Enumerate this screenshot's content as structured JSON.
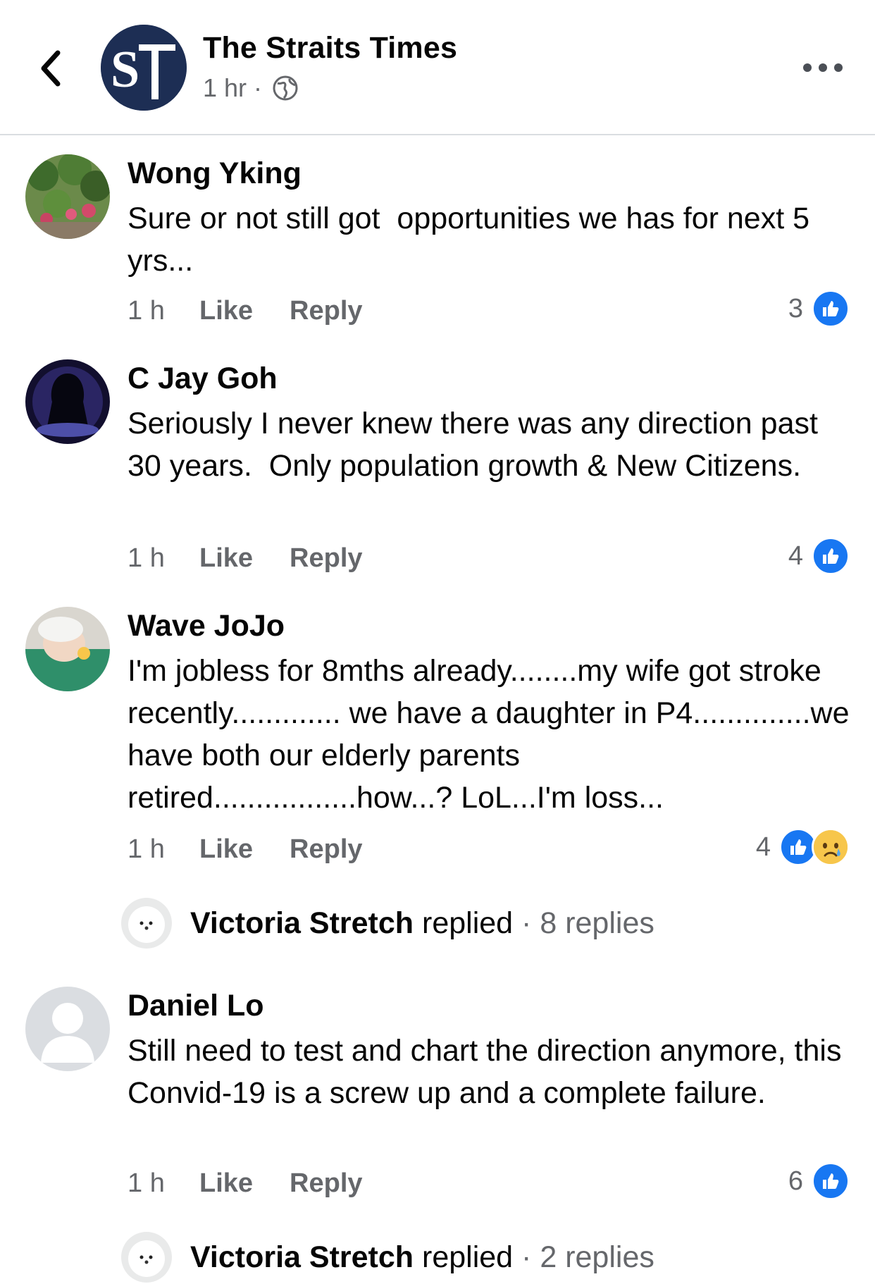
{
  "header": {
    "page_name": "The Straits Times",
    "time": "1 hr",
    "separator": "·",
    "privacy_icon": "globe-icon",
    "back_icon": "chevron-left-icon",
    "more_icon": "more-horizontal-icon",
    "logo_text": "ST",
    "brand_color": "#1d2e54"
  },
  "actions": {
    "like_label": "Like",
    "reply_label": "Reply"
  },
  "comments": [
    {
      "name": "Wong Yking",
      "text": "Sure or not still got  opportunities we has for next 5 yrs...",
      "time": "1 h",
      "reaction_count": "3",
      "reactions": [
        "like-icon"
      ]
    },
    {
      "name": "C Jay Goh",
      "text": "Seriously I never knew there was any direction past 30 years.  Only population growth & New Citizens.",
      "time": "1 h",
      "reaction_count": "4",
      "reactions": [
        "like-icon"
      ]
    },
    {
      "name": "Wave JoJo",
      "text": "I'm jobless for 8mths already........my wife got stroke recently............. we have a daughter in P4..............we have both our elderly parents retired.................how...? LoL...I'm loss...",
      "time": "1 h",
      "reaction_count": "4",
      "reactions": [
        "like-icon",
        "sad-icon"
      ],
      "reply_summary": {
        "name": "Victoria Stretch",
        "verb": "replied",
        "separator": "·",
        "count": "8 replies"
      }
    },
    {
      "name": "Daniel Lo",
      "text": "Still need to test and chart the direction anymore, this Convid-19 is a screw up and a complete failure.",
      "time": "1 h",
      "reaction_count": "6",
      "reactions": [
        "like-icon"
      ],
      "reply_summary": {
        "name": "Victoria Stretch",
        "verb": "replied",
        "separator": "·",
        "count": "2 replies"
      }
    }
  ],
  "colors": {
    "like_blue": "#1877f2",
    "secondary_text": "#65676b",
    "divider": "#dadde1"
  }
}
